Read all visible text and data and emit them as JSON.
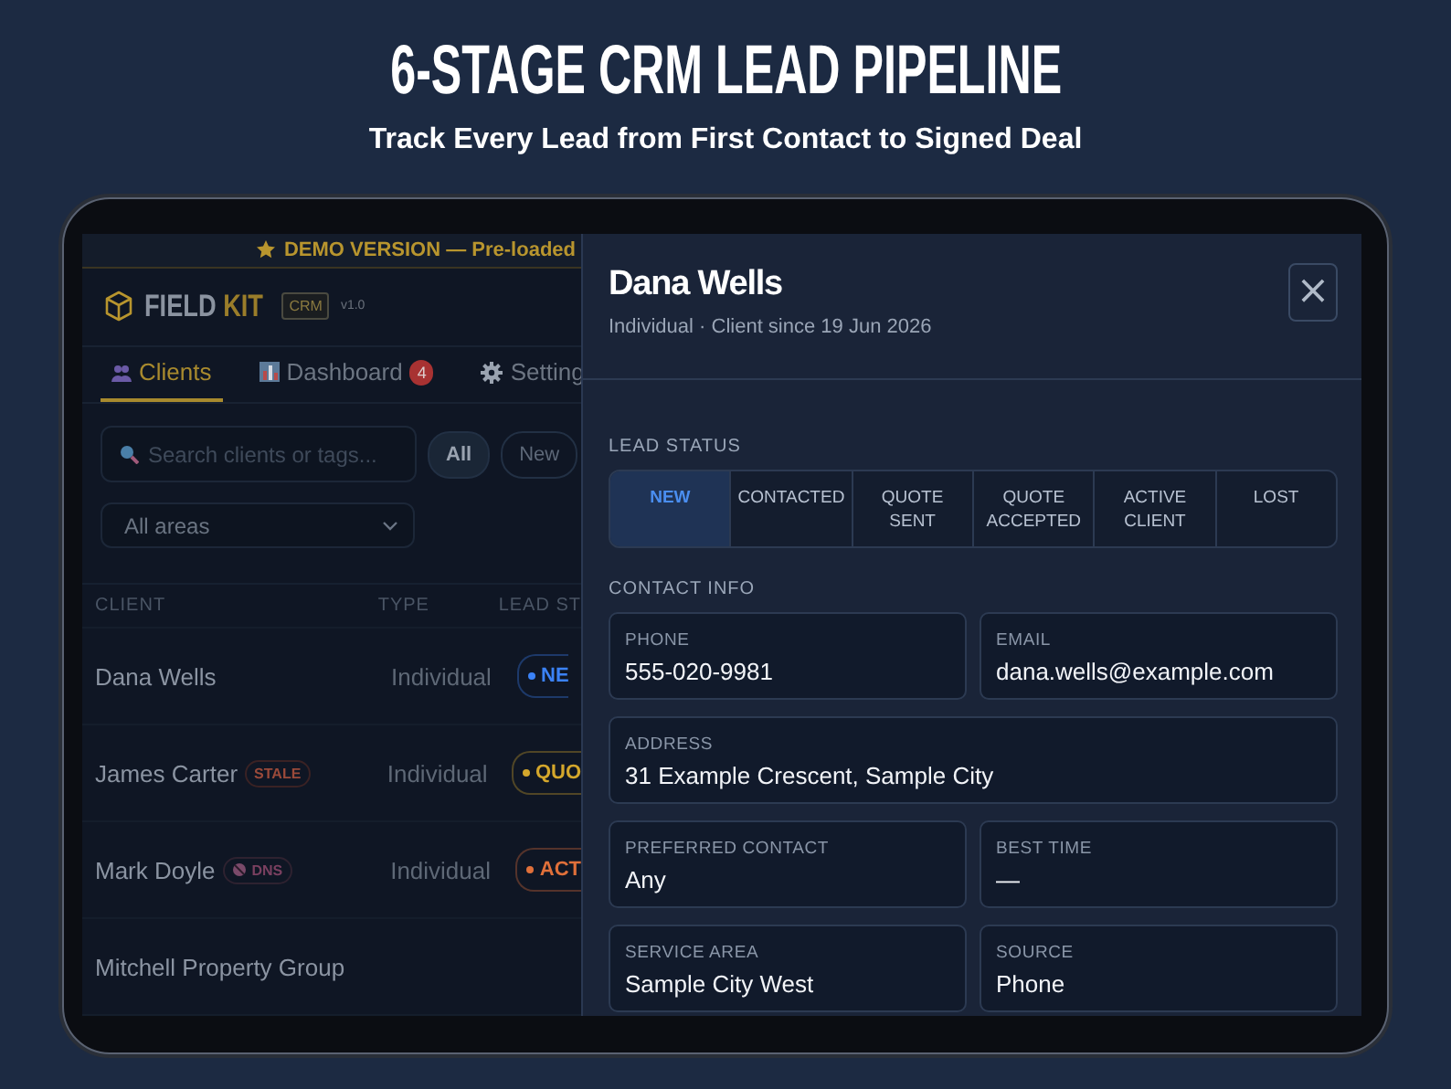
{
  "header": {
    "title": "6-STAGE CRM LEAD PIPELINE",
    "subtitle": "Track Every Lead from First Contact to Signed Deal"
  },
  "app": {
    "demo_banner": "DEMO VERSION — Pre-loaded",
    "logo": {
      "word_1": "FIELD",
      "word_2": "KIT",
      "badge": "CRM",
      "version": "v1.0"
    },
    "tabs": [
      {
        "label": "Clients",
        "selected": true
      },
      {
        "label": "Dashboard",
        "badge": "4",
        "selected": false
      },
      {
        "label": "Setting",
        "selected": false
      }
    ],
    "search": {
      "placeholder": "Search clients or tags..."
    },
    "filters": [
      {
        "label": "All",
        "selected": true
      },
      {
        "label": "New",
        "selected": false
      }
    ],
    "area_select": {
      "value": "All areas"
    },
    "table": {
      "columns": [
        "CLIENT",
        "TYPE",
        "LEAD ST"
      ],
      "rows": [
        {
          "client": "Dana Wells",
          "type": "Individual",
          "status": "NE",
          "color": "#3b82f6"
        },
        {
          "client": "James Carter",
          "tag": {
            "kind": "stale",
            "label": "STALE"
          },
          "type": "Individual",
          "status": "QUO",
          "color": "#d4a72c"
        },
        {
          "client": "Mark Doyle",
          "tag": {
            "kind": "dns",
            "label": "DNS"
          },
          "type": "Individual",
          "status": "ACT",
          "color": "#e0703a"
        },
        {
          "client": "Mitchell Property Group"
        }
      ]
    }
  },
  "drawer": {
    "title": "Dana Wells",
    "subtitle": "Individual · Client since 19 Jun 2026",
    "close": "×",
    "lead_status": {
      "label": "LEAD STATUS",
      "stages": [
        {
          "label": "NEW",
          "selected": true
        },
        {
          "label": "CONTACTED",
          "selected": false
        },
        {
          "label": "QUOTE SENT",
          "selected": false
        },
        {
          "label": "QUOTE ACCEPTED",
          "selected": false
        },
        {
          "label": "ACTIVE CLIENT",
          "selected": false
        },
        {
          "label": "LOST",
          "selected": false
        }
      ]
    },
    "contact_info": {
      "label": "CONTACT INFO",
      "fields": [
        {
          "label": "PHONE",
          "value": "555-020-9981",
          "wide": false
        },
        {
          "label": "EMAIL",
          "value": "dana.wells@example.com",
          "wide": false
        },
        {
          "label": "ADDRESS",
          "value": "31 Example Crescent, Sample City",
          "wide": true
        },
        {
          "label": "PREFERRED CONTACT",
          "value": "Any",
          "wide": false
        },
        {
          "label": "BEST TIME",
          "value": "—",
          "wide": false
        },
        {
          "label": "SERVICE AREA",
          "value": "Sample City West",
          "wide": false
        },
        {
          "label": "SOURCE",
          "value": "Phone",
          "wide": false
        }
      ]
    }
  }
}
